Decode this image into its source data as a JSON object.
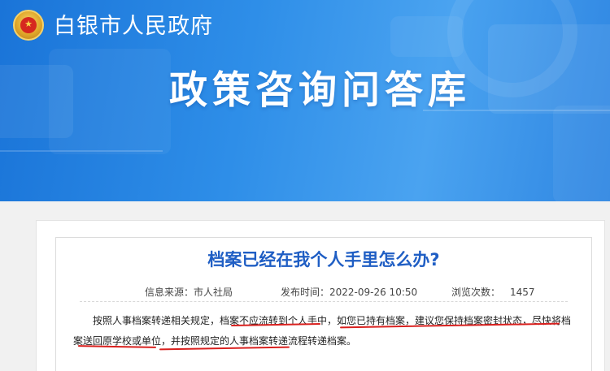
{
  "header": {
    "site_name": "白银市人民政府",
    "banner_title": "政策咨询问答库"
  },
  "article": {
    "title": "档案已经在我个人手里怎么办?",
    "source_label": "信息来源：市人社局",
    "time_label": "发布时间：2022-09-26 10:50",
    "views_label": "浏览次数：",
    "views_count": "1457",
    "body": "按照人事档案转递相关规定，档案不应流转到个人手中，如您已持有档案，建议您保持档案密封状态，尽快将档案送回原学校或单位，并按照规定的人事档案转递流程转递档案。"
  },
  "colors": {
    "banner_blue": "#2e8ee8",
    "title_blue": "#1f5ec4",
    "annotation_red": "#d9201e"
  },
  "icons": {
    "emblem": "national-emblem-icon"
  }
}
